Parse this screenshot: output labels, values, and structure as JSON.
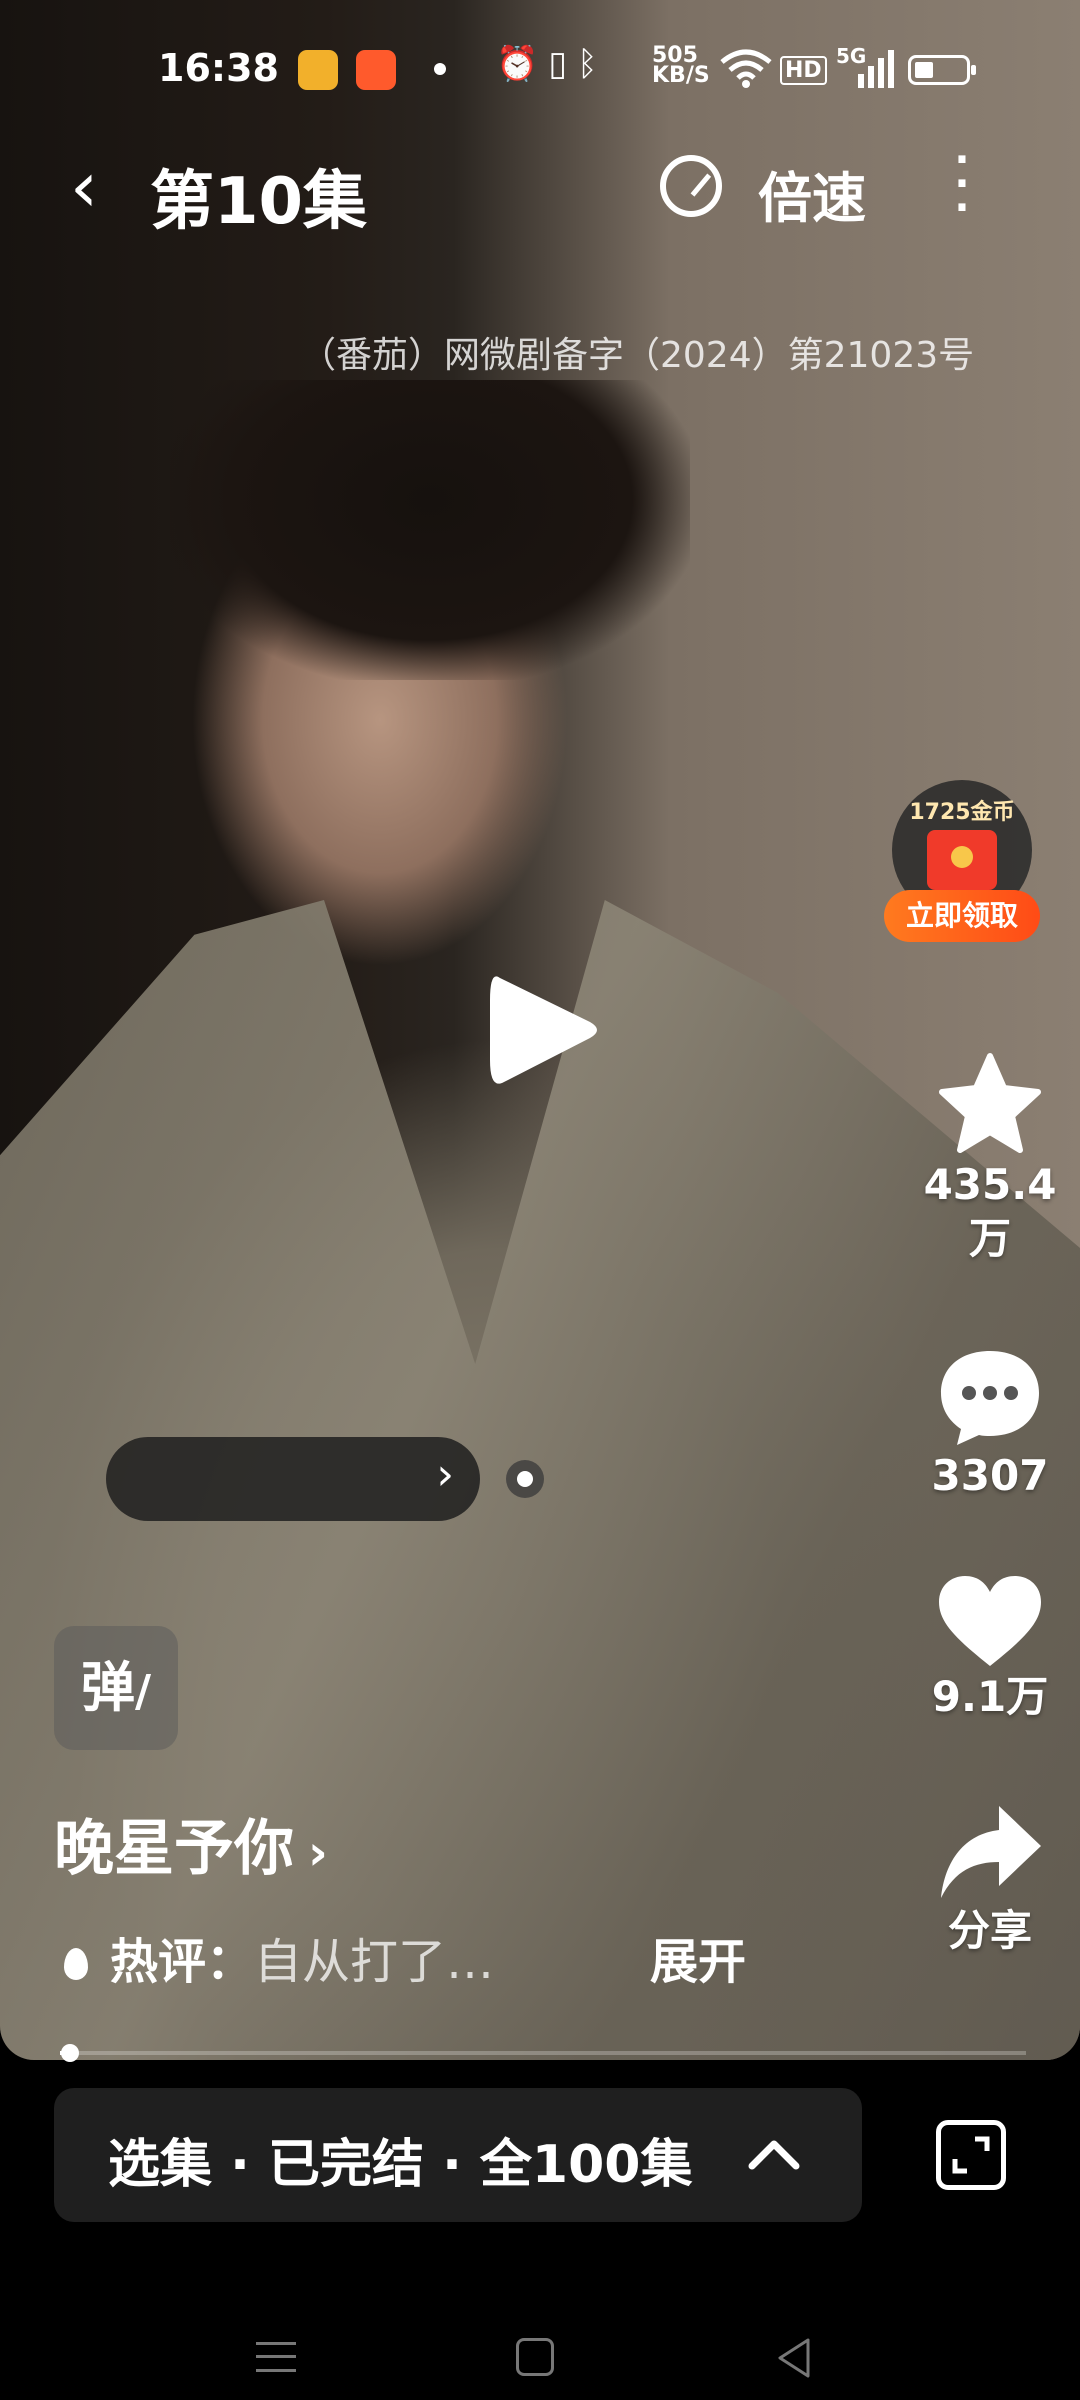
{
  "status_bar": {
    "time": "16:38",
    "net_speed_value": "505",
    "net_speed_unit": "KB/S",
    "icons": [
      "orange-app-icon",
      "red-app-icon",
      "dot-icon",
      "alarm-icon",
      "vibrate-icon",
      "bluetooth-icon",
      "wifi-icon",
      "hd-icon",
      "5g-signal-icon",
      "battery-icon"
    ],
    "hd": "HD",
    "network": "5G"
  },
  "header": {
    "back_glyph": "‹",
    "episode_title": "第10集",
    "speed_label": "倍速",
    "more_glyph": "⋮"
  },
  "license_text": "（番茄）网微剧备字（2024）第21023号",
  "coin_reward": {
    "amount": "1725金币",
    "claim_label": "立即领取"
  },
  "actions": {
    "favorite_count": "435.4\n万",
    "comment_count": "3307",
    "like_count": "9.1万",
    "share_label": "分享"
  },
  "danmu": {
    "toggle_label": "弹",
    "bar_chevron": "›"
  },
  "drama": {
    "title": "晚星予你",
    "title_arrow": "›",
    "hot_label": "热评：",
    "hot_comment": "自从打了…",
    "expand_label": "展开"
  },
  "playback": {
    "progress": 0.01
  },
  "episodes_bar": {
    "text": "选集 · 已完结 · 全100集",
    "chevron": "⌃"
  },
  "colors": {
    "claim_orange": "#ff5a1a",
    "coin_text": "#ffe7b0",
    "panel": "#1f1f1f"
  }
}
